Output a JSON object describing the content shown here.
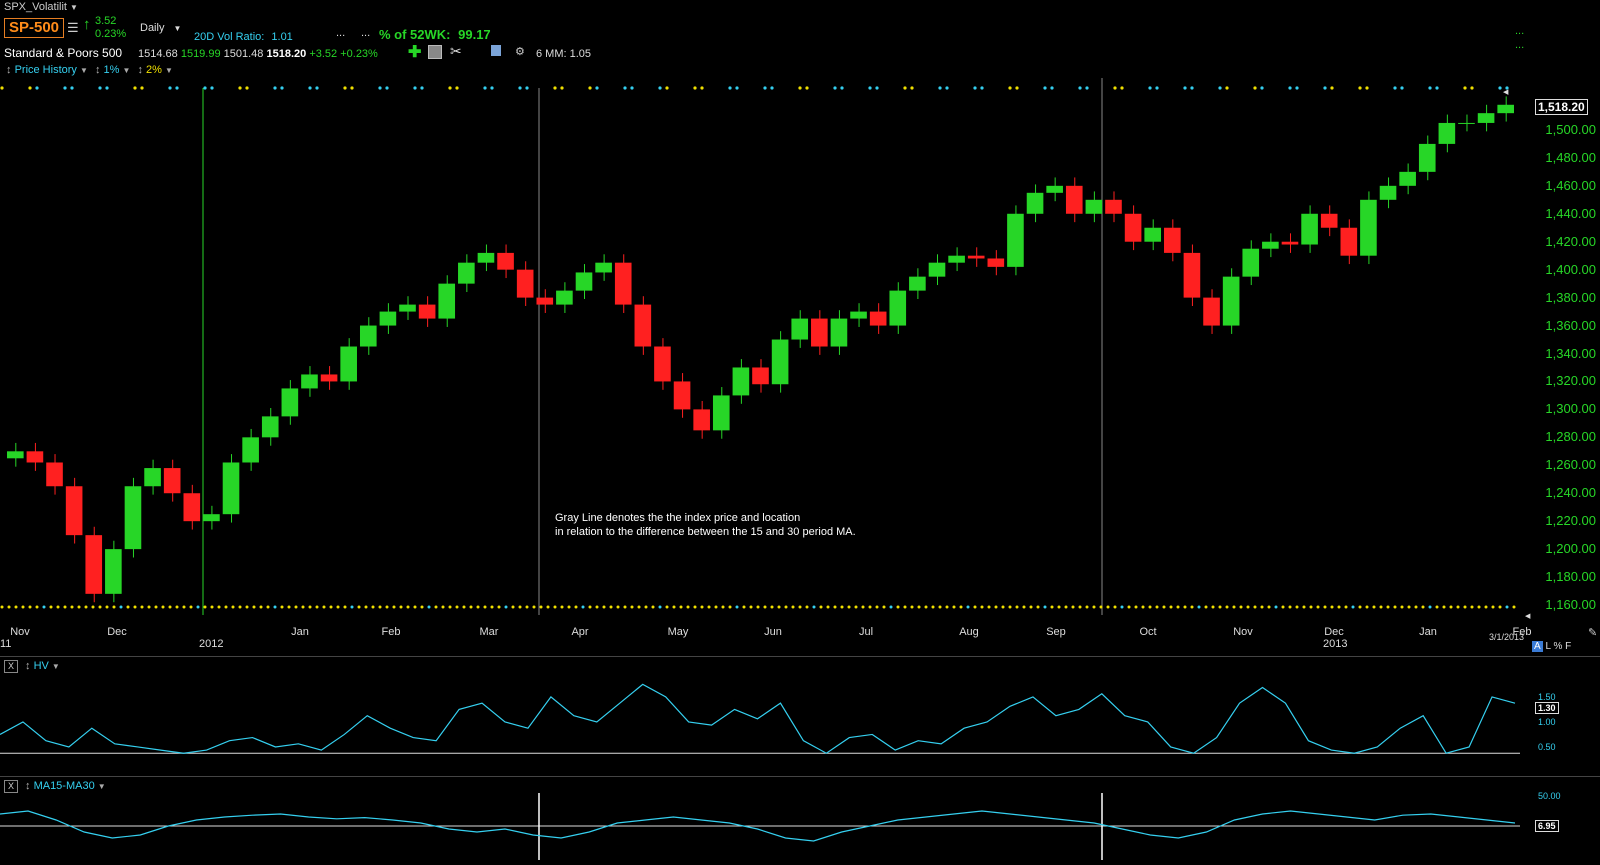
{
  "title_bar": {
    "chart_name": "SPX_Volatilit",
    "dropdown_icon": "caret-down-icon"
  },
  "symbol": {
    "ticker": "SP-500",
    "change": "3.52",
    "change_pct": "0.23%",
    "name": "Standard & Poors 500"
  },
  "quote": {
    "open": "1514.68",
    "high": "1519.99",
    "low": "1501.48",
    "close": "1518.20",
    "change": "+3.52",
    "change_pct": "+0.23%"
  },
  "toolbar": {
    "period": "Daily",
    "vol_ratio_label": "20D Vol Ratio:",
    "vol_ratio_value": "1.01",
    "ellipsis1": "...",
    "ellipsis2": "...",
    "pct52_label": "% of 52WK:",
    "pct52_value": "99.17",
    "mm_label": "6 MM:",
    "mm_value": "1.05",
    "right_dots": "...",
    "right_dots2": "..."
  },
  "subbar": {
    "price_history": "Price History",
    "pct1": "1%",
    "pct2": "2%"
  },
  "main_axis": {
    "ticks": [
      "1,500.00",
      "1,480.00",
      "1,460.00",
      "1,440.00",
      "1,420.00",
      "1,400.00",
      "1,380.00",
      "1,360.00",
      "1,340.00",
      "1,320.00",
      "1,300.00",
      "1,280.00",
      "1,260.00",
      "1,240.00",
      "1,220.00",
      "1,200.00",
      "1,180.00",
      "1,160.00"
    ],
    "last_value": "1,518.20"
  },
  "x_axis": {
    "months": [
      "Nov",
      "Dec",
      "Jan",
      "Feb",
      "Mar",
      "Apr",
      "May",
      "Jun",
      "Jul",
      "Aug",
      "Sep",
      "Oct",
      "Nov",
      "Dec",
      "Jan",
      "Feb"
    ],
    "years": [
      "11",
      "2012",
      "2013"
    ],
    "last_date": "3/1/2013"
  },
  "annotation": {
    "line1": "Gray Line denotes the the index price and location",
    "line2": "in relation to the difference between the 15 and 30 period MA."
  },
  "scale_buttons": {
    "a": "A",
    "l": "L",
    "pct": "%",
    "f": "F"
  },
  "hv_panel": {
    "close_label": "X",
    "name": "HV",
    "ticks": [
      "1.50",
      "1.00",
      "0.50"
    ],
    "last_value": "1.30"
  },
  "ma_panel": {
    "close_label": "X",
    "name": "MA15-MA30",
    "ticks": [
      "50.00"
    ],
    "last_value": "6.95"
  },
  "colors": {
    "up": "#27d627",
    "down": "#ff2020",
    "accent": "#ff8c1a",
    "cyan": "#35d0f0",
    "yellow": "#f0e000"
  },
  "chart_data": [
    {
      "type": "candlestick",
      "series": [
        {
          "name": "SP-500",
          "values": [
            1270,
            1262,
            1245,
            1210,
            1168,
            1200,
            1245,
            1258,
            1240,
            1220,
            1225,
            1262,
            1280,
            1295,
            1315,
            1325,
            1320,
            1345,
            1360,
            1370,
            1375,
            1365,
            1390,
            1405,
            1412,
            1400,
            1380,
            1375,
            1385,
            1398,
            1405,
            1375,
            1345,
            1320,
            1300,
            1285,
            1310,
            1330,
            1318,
            1350,
            1365,
            1345,
            1365,
            1370,
            1360,
            1385,
            1395,
            1405,
            1410,
            1408,
            1402,
            1440,
            1455,
            1460,
            1440,
            1450,
            1440,
            1420,
            1430,
            1412,
            1380,
            1360,
            1395,
            1415,
            1420,
            1418,
            1440,
            1430,
            1410,
            1450,
            1460,
            1470,
            1490,
            1505,
            1505,
            1512,
            1518
          ]
        }
      ],
      "y_ticks": [
        "1,500.00",
        "1,160.00"
      ],
      "ylim": [
        1155,
        1525
      ]
    },
    {
      "type": "line",
      "series": [
        {
          "name": "HV",
          "values": [
            0.8,
            1.0,
            0.7,
            0.6,
            0.9,
            0.65,
            0.6,
            0.55,
            0.5,
            0.55,
            0.7,
            0.75,
            0.6,
            0.65,
            0.55,
            0.8,
            1.1,
            0.9,
            0.75,
            0.7,
            1.2,
            1.3,
            1.0,
            0.9,
            1.4,
            1.1,
            1.0,
            1.3,
            1.6,
            1.4,
            1.0,
            0.95,
            1.2,
            1.05,
            1.3,
            0.7,
            0.5,
            0.75,
            0.8,
            0.55,
            0.7,
            0.65,
            0.9,
            1.0,
            1.25,
            1.4,
            1.1,
            1.2,
            1.45,
            1.1,
            1.0,
            0.6,
            0.5,
            0.75,
            1.3,
            1.55,
            1.3,
            0.7,
            0.55,
            0.5,
            0.6,
            0.9,
            1.1,
            0.5,
            0.6,
            1.4,
            1.3
          ]
        }
      ],
      "y_ticks": [
        "1.50",
        "1.00",
        "0.50"
      ],
      "ylim": [
        0.2,
        1.75
      ]
    },
    {
      "type": "line",
      "series": [
        {
          "name": "MA15-MA30",
          "values": [
            20,
            25,
            10,
            -10,
            -20,
            -15,
            0,
            10,
            15,
            18,
            20,
            15,
            12,
            14,
            10,
            5,
            -5,
            -10,
            -5,
            -15,
            -20,
            -10,
            5,
            10,
            15,
            10,
            5,
            -5,
            -20,
            -25,
            -10,
            0,
            10,
            15,
            20,
            25,
            20,
            15,
            10,
            5,
            -5,
            -15,
            -20,
            -10,
            10,
            20,
            25,
            20,
            15,
            10,
            18,
            20,
            15,
            10,
            5
          ]
        }
      ],
      "y_ticks": [
        "50.00"
      ],
      "ylim": [
        -60,
        60
      ]
    }
  ]
}
